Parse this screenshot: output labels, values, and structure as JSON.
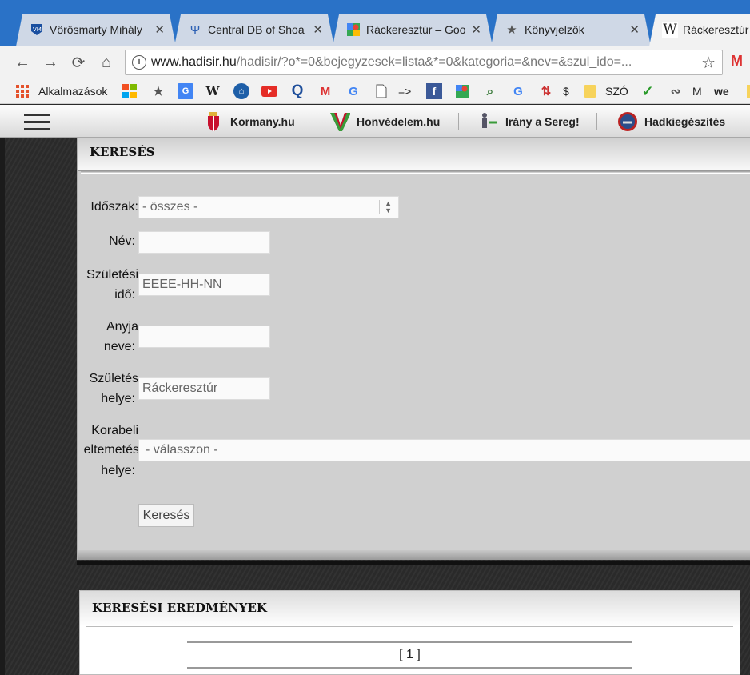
{
  "tabs": [
    {
      "title": "Vörösmarty Mihály",
      "icon": "vm-school-icon",
      "active": false
    },
    {
      "title": "Central DB of Shoa",
      "icon": "yad-vashem-icon",
      "active": false
    },
    {
      "title": "Ráckeresztúr – Goo",
      "icon": "google-maps-icon",
      "active": false
    },
    {
      "title": "Könyvjelzők",
      "icon": "star-icon",
      "active": false
    },
    {
      "title": "Ráckeresztúr",
      "icon": "wikipedia-icon",
      "active": true
    }
  ],
  "address": {
    "host": "www.hadisir.hu",
    "path": "/hadisir/?o*=0&bejegyzesek=lista&*=0&kategoria=&nev=&szul_ido=..."
  },
  "bookmarks": {
    "apps_label": "Alkalmazások",
    "text_items": [
      "=>",
      "$",
      "SZÓ",
      "M",
      "we"
    ]
  },
  "site_nav": {
    "links": [
      "Kormany.hu",
      "Honvédelem.hu",
      "Irány a Sereg!",
      "Hadkiegészítés"
    ]
  },
  "search": {
    "heading": "KERESÉS",
    "fields": {
      "period_label": "Időszak:",
      "period_value": "- összes -",
      "name_label": "Név:",
      "name_value": "",
      "birth_date_label_1": "Születési",
      "birth_date_label_2": "idő:",
      "birth_date_placeholder": "EEEE-HH-NN",
      "mother_label_1": "Anyja",
      "mother_label_2": "neve:",
      "mother_value": "",
      "birthplace_label_1": "Születés",
      "birthplace_label_2": "helye:",
      "birthplace_value": "Ráckeresztúr",
      "burial_label_1": "Korabeli",
      "burial_label_2": "eltemetés",
      "burial_label_3": "helye:",
      "burial_value": "- válasszon -"
    },
    "button_label": "Keresés"
  },
  "results": {
    "heading": "KERESÉSI EREDMÉNYEK",
    "pager": "[ 1 ]"
  }
}
